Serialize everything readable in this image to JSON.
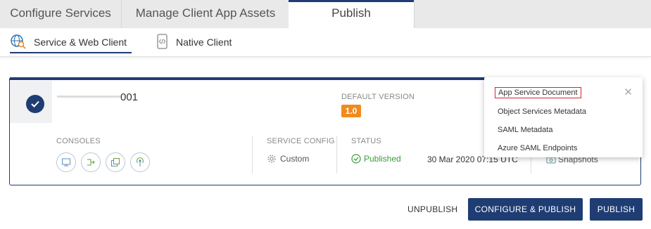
{
  "tabs": {
    "top": [
      "Configure Services",
      "Manage Client App Assets",
      "Publish"
    ],
    "sub": [
      "Service & Web Client",
      "Native Client"
    ]
  },
  "service": {
    "name_suffix": "001",
    "default_version_label": "DEFAULT VERSION",
    "default_version": "1.0",
    "consoles_label": "CONSOLES",
    "service_config_label": "SERVICE CONFIG",
    "service_config_value": "Custom",
    "status_label": "STATUS",
    "status_value": "Published",
    "status_date": "30 Mar 2020 07:15 UTC",
    "snapshots_label": "Snapshots"
  },
  "dropdown": {
    "items": [
      "App Service Document",
      "Object Services Metadata",
      "SAML Metadata",
      "Azure SAML Endpoints"
    ],
    "close": "✕"
  },
  "actions": {
    "unpublish": "UNPUBLISH",
    "configure_publish": "CONFIGURE & PUBLISH",
    "publish": "PUBLISH"
  },
  "colors": {
    "primary": "#1f3d73",
    "badge": "#f08a1c",
    "success": "#3a9b3a",
    "highlight_border": "#d9232d"
  },
  "icons": [
    "globe-search-icon",
    "phone-code-icon",
    "check-icon",
    "gear-icon",
    "check-circle-icon",
    "camera-icon",
    "close-icon"
  ]
}
